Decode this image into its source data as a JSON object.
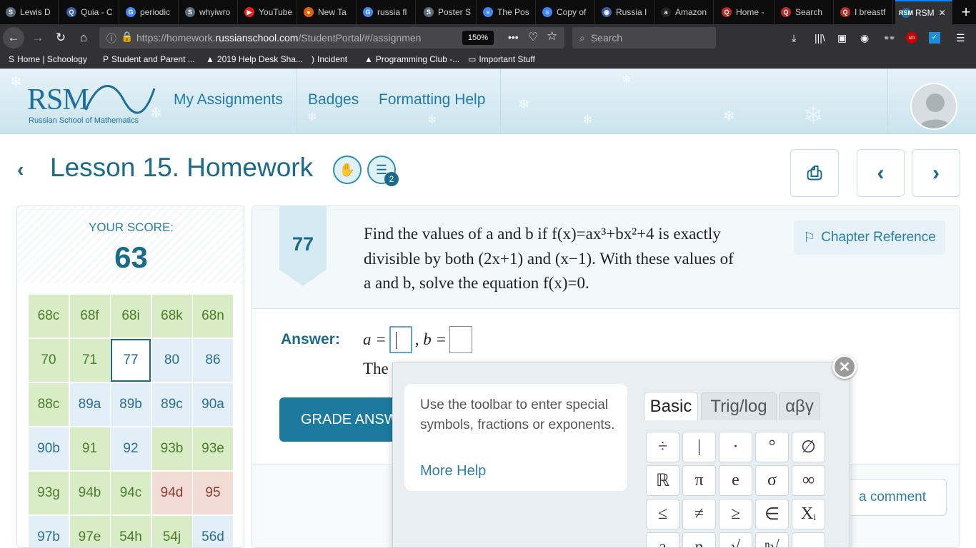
{
  "browser": {
    "tabs": [
      {
        "label": "Lewis D",
        "icon": "S",
        "color": "#5a6b7a"
      },
      {
        "label": "Quia - C",
        "icon": "Q",
        "color": "#3a5ea8"
      },
      {
        "label": "periodic",
        "icon": "G",
        "color": "#4285f4"
      },
      {
        "label": "whyiwro",
        "icon": "S",
        "color": "#5a6b7a"
      },
      {
        "label": "YouTube",
        "icon": "▶",
        "color": "#e62117"
      },
      {
        "label": "New Ta",
        "icon": "●",
        "color": "#e66000"
      },
      {
        "label": "russia fl",
        "icon": "G",
        "color": "#4285f4"
      },
      {
        "label": "Poster S",
        "icon": "S",
        "color": "#5a6b7a"
      },
      {
        "label": "The Pos",
        "icon": "≡",
        "color": "#4285f4"
      },
      {
        "label": "Copy of",
        "icon": "≡",
        "color": "#4285f4"
      },
      {
        "label": "Russia I",
        "icon": "◉",
        "color": "#3a5ea8"
      },
      {
        "label": "Amazon",
        "icon": "a",
        "color": "#222"
      },
      {
        "label": "Home -",
        "icon": "Q",
        "color": "#b92b27"
      },
      {
        "label": "Search",
        "icon": "Q",
        "color": "#b92b27"
      },
      {
        "label": "I breastf",
        "icon": "Q",
        "color": "#b92b27"
      },
      {
        "label": "RSM",
        "icon": "RSM",
        "color": "#1c6f9c"
      }
    ],
    "url_prefix": "https://homework.",
    "url_domain": "russianschool.com",
    "url_suffix": "/StudentPortal/#/assignmen",
    "zoom": "150%",
    "search_placeholder": "Search",
    "bookmarks": [
      {
        "label": "Home | Schoology",
        "icon": "S"
      },
      {
        "label": "Student and Parent ...",
        "icon": "P"
      },
      {
        "label": "2019 Help Desk Sha...",
        "icon": "▲"
      },
      {
        "label": "Incident",
        "icon": ")"
      },
      {
        "label": "Programming Club -...",
        "icon": "▲"
      },
      {
        "label": "Important Stuff",
        "icon": "▭"
      }
    ]
  },
  "header": {
    "logo": "RSM",
    "logo_sub": "Russian School of Mathematics",
    "nav": [
      "My Assignments",
      "Badges",
      "Formatting Help"
    ]
  },
  "lesson": {
    "title": "Lesson 15. Homework",
    "badge_count": "2"
  },
  "score": {
    "label": "YOUR SCORE:",
    "value": "63",
    "problems": [
      {
        "label": "68c",
        "status": "g"
      },
      {
        "label": "68f",
        "status": "g"
      },
      {
        "label": "68i",
        "status": "g"
      },
      {
        "label": "68k",
        "status": "g"
      },
      {
        "label": "68n",
        "status": "g"
      },
      {
        "label": "70",
        "status": "g"
      },
      {
        "label": "71",
        "status": "g"
      },
      {
        "label": "77",
        "status": "sel"
      },
      {
        "label": "80",
        "status": "b"
      },
      {
        "label": "86",
        "status": "b"
      },
      {
        "label": "88c",
        "status": "g"
      },
      {
        "label": "89a",
        "status": "b"
      },
      {
        "label": "89b",
        "status": "b"
      },
      {
        "label": "89c",
        "status": "b"
      },
      {
        "label": "90a",
        "status": "b"
      },
      {
        "label": "90b",
        "status": "b"
      },
      {
        "label": "91",
        "status": "g"
      },
      {
        "label": "92",
        "status": "b"
      },
      {
        "label": "93b",
        "status": "g"
      },
      {
        "label": "93e",
        "status": "g"
      },
      {
        "label": "93g",
        "status": "g"
      },
      {
        "label": "94b",
        "status": "g"
      },
      {
        "label": "94c",
        "status": "g"
      },
      {
        "label": "94d",
        "status": "r"
      },
      {
        "label": "95",
        "status": "r"
      },
      {
        "label": "97b",
        "status": "b"
      },
      {
        "label": "97e",
        "status": "g"
      },
      {
        "label": "54h",
        "status": "g"
      },
      {
        "label": "54j",
        "status": "g"
      },
      {
        "label": "56d",
        "status": "b"
      }
    ]
  },
  "problem": {
    "number": "77",
    "text_lines": [
      "Find the values of a and b if f(x)=ax³+bx²+4 is exactly",
      "divisible by both (2x+1) and (x−1). With these values of",
      "a and b, solve the equation f(x)=0."
    ],
    "chapter_ref": "Chapter Reference",
    "answer_label": "Answer:",
    "answer_a": "a =",
    "answer_b": ", b =",
    "partial_text": "The",
    "grade_btn": "GRADE ANSWER",
    "comment_btn": "a comment"
  },
  "keyboard": {
    "help_text": "Use the toolbar to enter special symbols, fractions or exponents.",
    "more_help": "More Help",
    "tabs": [
      "Basic",
      "Trig/log",
      "αβγ"
    ],
    "keys": [
      [
        "÷",
        "|",
        "·",
        "°",
        "∅"
      ],
      [
        "ℝ",
        "π",
        "e",
        "σ",
        "∞"
      ],
      [
        "≤",
        "≠",
        "≥",
        "∈",
        "Xᵢ"
      ],
      [
        "a",
        "n",
        "√",
        "ⁿ√",
        "→"
      ]
    ],
    "close": "✕"
  }
}
